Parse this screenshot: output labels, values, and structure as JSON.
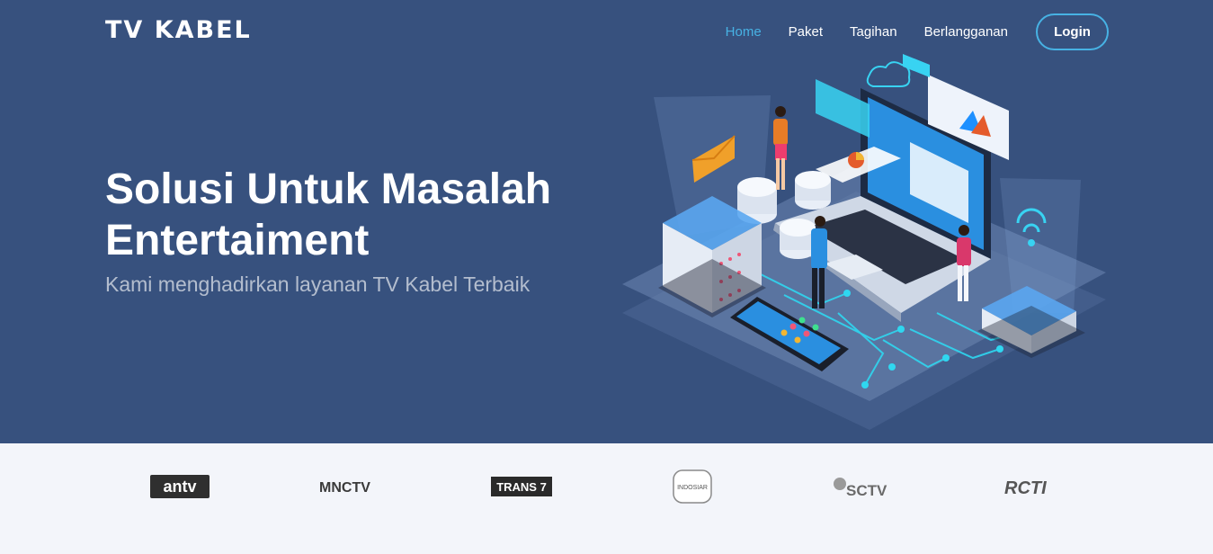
{
  "brand": "TV KABEL",
  "nav": {
    "items": [
      "Home",
      "Paket",
      "Tagihan",
      "Berlangganan"
    ],
    "active": "Home",
    "login_label": "Login"
  },
  "hero": {
    "title_line1": "Solusi Untuk Masalah",
    "title_line2": "Entertaiment",
    "subtitle": "Kami menghadirkan layanan TV Kabel Terbaik"
  },
  "clients": {
    "logos": [
      "antv",
      "MNCTV",
      "TRANS 7",
      "INDOSIAR",
      "SCTV",
      "RCTI"
    ]
  },
  "colors": {
    "hero_bg": "#37517e",
    "accent": "#47b2e4",
    "section_bg": "#f3f5fa"
  }
}
